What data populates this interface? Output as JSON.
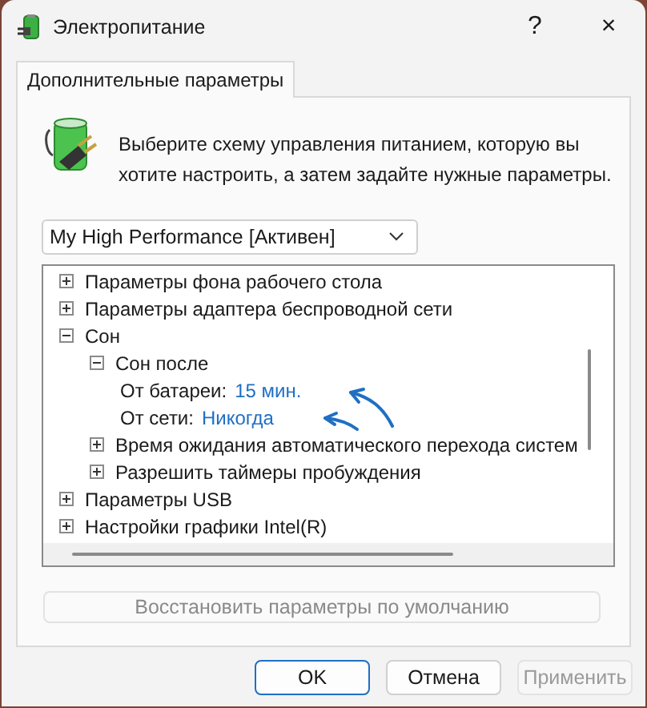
{
  "window": {
    "title": "Электропитание",
    "help": "?",
    "close": "×"
  },
  "tabs": [
    {
      "label": "Дополнительные параметры",
      "selected": true
    }
  ],
  "intro": "Выберите схему управления питанием, которую вы хотите настроить, а затем задайте нужные параметры.",
  "plan_dropdown": {
    "value": "My High Performance [Активен]"
  },
  "tree": [
    {
      "kind": "group",
      "label": "Параметры фона рабочего стола",
      "expanded": false
    },
    {
      "kind": "group",
      "label": "Параметры адаптера беспроводной сети",
      "expanded": false
    },
    {
      "kind": "group",
      "label": "Сон",
      "expanded": true,
      "children": [
        {
          "kind": "group",
          "label": "Сон после",
          "expanded": true,
          "children": [
            {
              "kind": "setting",
              "label": "От батареи:",
              "value": "15 мин."
            },
            {
              "kind": "setting",
              "label": "От сети:",
              "value": "Никогда"
            }
          ]
        },
        {
          "kind": "group",
          "label": "Время ожидания автоматического перехода систем",
          "expanded": false
        },
        {
          "kind": "group",
          "label": "Разрешить таймеры пробуждения",
          "expanded": false
        }
      ]
    },
    {
      "kind": "group",
      "label": "Параметры USB",
      "expanded": false
    },
    {
      "kind": "group",
      "label": "Настройки графики Intel(R)",
      "expanded": false
    }
  ],
  "restore_button": {
    "label": "Восстановить параметры по умолчанию",
    "disabled": true
  },
  "buttons": [
    {
      "label": "OK",
      "default": true,
      "disabled": false
    },
    {
      "label": "Отмена",
      "default": false,
      "disabled": false
    },
    {
      "label": "Применить",
      "default": false,
      "disabled": true
    }
  ]
}
